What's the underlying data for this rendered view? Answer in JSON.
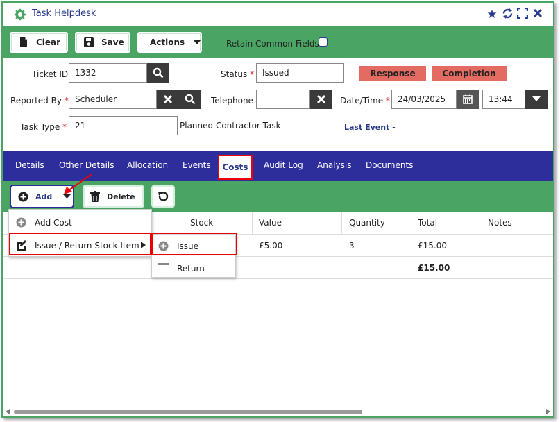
{
  "window": {
    "title": "Task Helpdesk"
  },
  "toolbar": {
    "clear_label": "Clear",
    "save_label": "Save",
    "actions_label": "Actions",
    "retain_label": "Retain Common Fields",
    "retain_checked": false
  },
  "form": {
    "ticket_id_label": "Ticket ID",
    "ticket_id_value": "1332",
    "status_label": "Status",
    "status_value": "Issued",
    "response_label": "Response",
    "completion_label": "Completion",
    "reported_by_label": "Reported By",
    "reported_by_value": "Scheduler",
    "telephone_label": "Telephone",
    "telephone_value": "",
    "datetime_label": "Date/Time",
    "date_value": "24/03/2025",
    "time_value": "13:44",
    "task_type_label": "Task Type",
    "task_type_value": "21",
    "task_type_desc": "Planned Contractor Task",
    "last_event_label": "Last Event -",
    "required_marker": "*"
  },
  "tabs": [
    "Details",
    "Other Details",
    "Allocation",
    "Events",
    "Costs",
    "Audit Log",
    "Analysis",
    "Documents"
  ],
  "active_tab": "Costs",
  "costs_toolbar": {
    "add_label": "Add",
    "delete_label": "Delete"
  },
  "table": {
    "columns": [
      "Stock",
      "Value",
      "Quantity",
      "Total",
      "Notes"
    ],
    "rows": [
      {
        "stock": "",
        "value": "£5.00",
        "quantity": "3",
        "total": "£15.00",
        "notes": ""
      }
    ],
    "grand_total": "£15.00"
  },
  "add_menu": {
    "items": [
      "Add Cost",
      "Issue / Return Stock Item"
    ],
    "submenu": [
      "Issue",
      "Return"
    ]
  },
  "colors": {
    "accent_green": "#4aa564",
    "tab_blue": "#2d2d9c",
    "title_blue": "#2a3a8c",
    "highlight_red": "#e00000",
    "status_button": "#e46b61"
  }
}
